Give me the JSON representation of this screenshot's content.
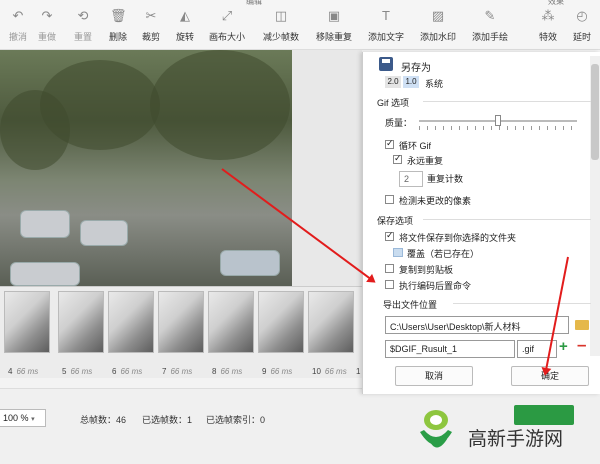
{
  "toolbar": {
    "group_edit": "编辑",
    "group_effects": "效果",
    "buttons": [
      {
        "label": "撤消",
        "icon": "undo-icon",
        "enabled": false
      },
      {
        "label": "重做",
        "icon": "redo-icon",
        "enabled": false
      },
      {
        "label": "重置",
        "icon": "reset-icon",
        "enabled": false
      },
      {
        "label": "删除",
        "icon": "trash-icon",
        "enabled": true
      },
      {
        "label": "裁剪",
        "icon": "scissors-icon",
        "enabled": true
      },
      {
        "label": "旋转",
        "icon": "rotate-icon",
        "enabled": true
      },
      {
        "label": "画布大小",
        "icon": "resize-icon",
        "enabled": true
      },
      {
        "label": "减少帧数",
        "icon": "frames-icon",
        "enabled": true
      },
      {
        "label": "移除重复",
        "icon": "remove-duplicate-icon",
        "enabled": true
      },
      {
        "label": "添加文字",
        "icon": "text-icon",
        "enabled": true
      },
      {
        "label": "添加水印",
        "icon": "watermark-icon",
        "enabled": true
      },
      {
        "label": "添加手绘",
        "icon": "pencil-icon",
        "enabled": true
      },
      {
        "label": "特效",
        "icon": "effects-icon",
        "enabled": true
      },
      {
        "label": "延时",
        "icon": "timer-icon",
        "enabled": true
      }
    ]
  },
  "frames": [
    {
      "index": "4",
      "duration": "66 ms"
    },
    {
      "index": "5",
      "duration": "66 ms"
    },
    {
      "index": "6",
      "duration": "66 ms"
    },
    {
      "index": "7",
      "duration": "66 ms"
    },
    {
      "index": "8",
      "duration": "66 ms"
    },
    {
      "index": "9",
      "duration": "66 ms"
    },
    {
      "index": "10",
      "duration": "66 ms"
    },
    {
      "index": "1",
      "duration": ""
    }
  ],
  "statusbar": {
    "zoom": "100",
    "zoom_unit": "%",
    "total_frames": "总帧数：46",
    "selected_frames": "已选帧数：1",
    "selected_index": "已选帧索引：0"
  },
  "dialog": {
    "title": "另存为",
    "encoder_v1": "2.0",
    "encoder_v2": "1.0",
    "encoder_system": "系统",
    "gif_section": "Gif 选项",
    "quality_label": "质量：",
    "quality_value": 0.5,
    "loop_gif": "循环 Gif",
    "forever_repeat": "永远重复",
    "repeat_count_value": "2",
    "repeat_count_label": "重复计数",
    "detect_unchanged": "检测未更改的像素",
    "save_section": "保存选项",
    "save_to_folder": "将文件保存到你选择的文件夹",
    "overwrite": "覆盖（若已存在）",
    "copy_clipboard": "复制到剪贴板",
    "run_command": "执行编码后置命令",
    "export_section": "导出文件位置",
    "path_value": "C:\\Users\\User\\Desktop\\新人材料",
    "filename_value": "$DGIF_Rusult_1",
    "extension": ".gif",
    "cancel": "取消",
    "ok": "确定"
  },
  "watermark": {
    "text": "高新手游网"
  },
  "colors": {
    "accent_green": "#2b9a43",
    "remove_red": "#d9342b",
    "annotation_red": "#e21c1c"
  }
}
